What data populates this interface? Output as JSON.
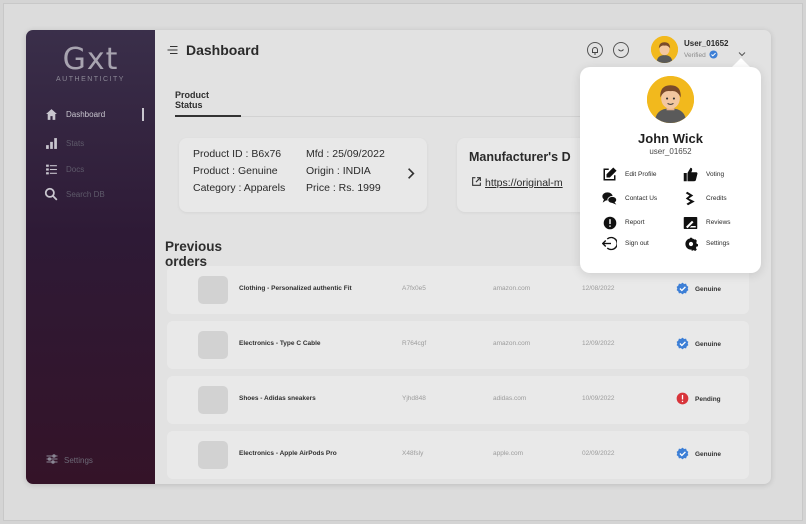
{
  "brand": {
    "logo": "Gxt",
    "tagline": "AUTHENTICITY"
  },
  "sidebar": {
    "items": [
      {
        "label": "Dashboard",
        "icon": "home-icon"
      },
      {
        "label": "Stats",
        "icon": "bar-chart-icon"
      },
      {
        "label": "Docs",
        "icon": "list-icon"
      },
      {
        "label": "Search DB",
        "icon": "search-icon"
      }
    ],
    "settings_label": "Settings"
  },
  "header": {
    "title": "Dashboard",
    "user": {
      "name": "User_01652",
      "status": "Verified"
    }
  },
  "tab": {
    "label": "Product Status"
  },
  "product": {
    "id": "Product ID : B6x76",
    "type": "Product : Genuine",
    "category": "Category : Apparels",
    "mfd": "Mfd : 25/09/2022",
    "origin": "Origin : INDIA",
    "price": "Price : Rs. 1999"
  },
  "manufacturer": {
    "title": "Manufacturer's D",
    "link": "https://original-m"
  },
  "orders": {
    "title": "Previous orders",
    "rows": [
      {
        "name": "Clothing - Personalized authentic Fit",
        "id": "A7fx0e5",
        "site": "amazon.com",
        "date": "12/08/2022",
        "status": "Genuine"
      },
      {
        "name": "Electronics - Type C Cable",
        "id": "R764cgf",
        "site": "amazon.com",
        "date": "12/09/2022",
        "status": "Genuine"
      },
      {
        "name": "Shoes - Adidas sneakers",
        "id": "Yjhd848",
        "site": "adidas.com",
        "date": "10/09/2022",
        "status": "Pending"
      },
      {
        "name": "Electronics - Apple AirPods Pro",
        "id": "X48fsly",
        "site": "apple.com",
        "date": "02/09/2022",
        "status": "Genuine"
      }
    ]
  },
  "profile_menu": {
    "name": "John Wick",
    "username": "user_01652",
    "items": [
      {
        "label": "Edit Profile",
        "icon": "edit-icon"
      },
      {
        "label": "Voting",
        "icon": "thumbs-up-icon"
      },
      {
        "label": "Contact Us",
        "icon": "chat-icon"
      },
      {
        "label": "Credits",
        "icon": "credits-icon"
      },
      {
        "label": "Report",
        "icon": "alert-icon"
      },
      {
        "label": "Reviews",
        "icon": "review-icon"
      },
      {
        "label": "Sign out",
        "icon": "sign-out-icon"
      },
      {
        "label": "Settings",
        "icon": "gear-icon"
      }
    ]
  },
  "colors": {
    "genuine": "#3d7fd6",
    "pending": "#d8343a",
    "accent": "#f2b91d"
  }
}
